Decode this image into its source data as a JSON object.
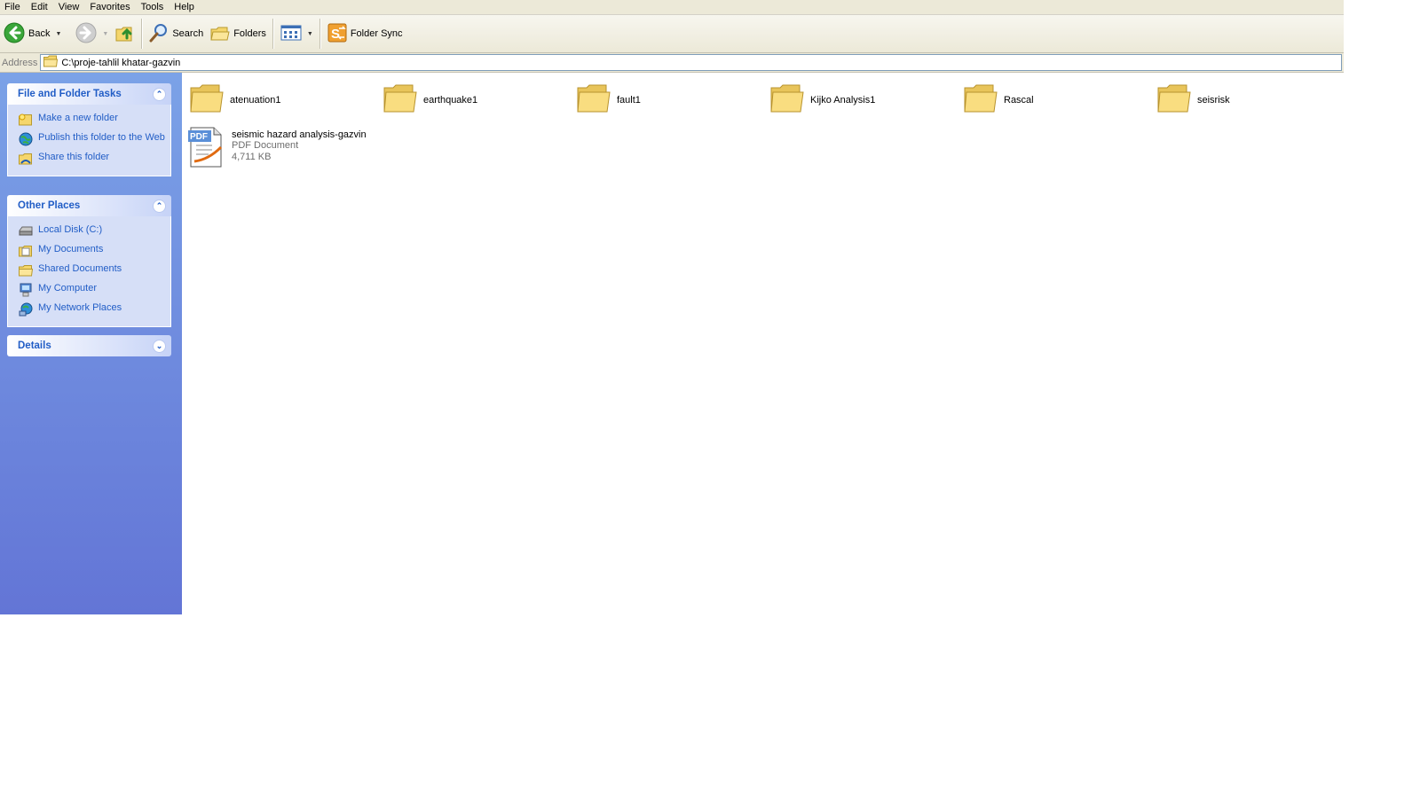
{
  "menu": [
    "File",
    "Edit",
    "View",
    "Favorites",
    "Tools",
    "Help"
  ],
  "toolbar": {
    "back_label": "Back",
    "search_label": "Search",
    "folders_label": "Folders",
    "foldersync_label": "Folder Sync"
  },
  "address": {
    "label": "Address",
    "path": "C:\\proje-tahlil khatar-gazvin"
  },
  "file_tasks": {
    "title": "File and Folder Tasks",
    "items": [
      {
        "label": "Make a new folder",
        "icon": "new-folder-icon"
      },
      {
        "label": "Publish this folder to the Web",
        "icon": "publish-web-icon"
      },
      {
        "label": "Share this folder",
        "icon": "share-folder-icon"
      }
    ]
  },
  "other_places": {
    "title": "Other Places",
    "items": [
      {
        "label": "Local Disk (C:)",
        "icon": "disk-drive-icon"
      },
      {
        "label": "My Documents",
        "icon": "my-documents-icon"
      },
      {
        "label": "Shared Documents",
        "icon": "shared-documents-icon"
      },
      {
        "label": "My Computer",
        "icon": "my-computer-icon"
      },
      {
        "label": "My Network Places",
        "icon": "network-places-icon"
      }
    ]
  },
  "details": {
    "title": "Details"
  },
  "folders": [
    {
      "name": "atenuation1"
    },
    {
      "name": "earthquake1"
    },
    {
      "name": "fault1"
    },
    {
      "name": "Kijko Analysis1"
    },
    {
      "name": "Rascal"
    },
    {
      "name": "seisrisk"
    }
  ],
  "files": [
    {
      "name": "seismic hazard analysis-gazvin",
      "type": "PDF Document",
      "size": "4,711 KB",
      "badge": "PDF"
    }
  ],
  "colors": {
    "taskpane_top": "#7ba2e7",
    "taskpane_bottom": "#6375d6",
    "link": "#215dc6",
    "folder": "#f5d66c"
  }
}
